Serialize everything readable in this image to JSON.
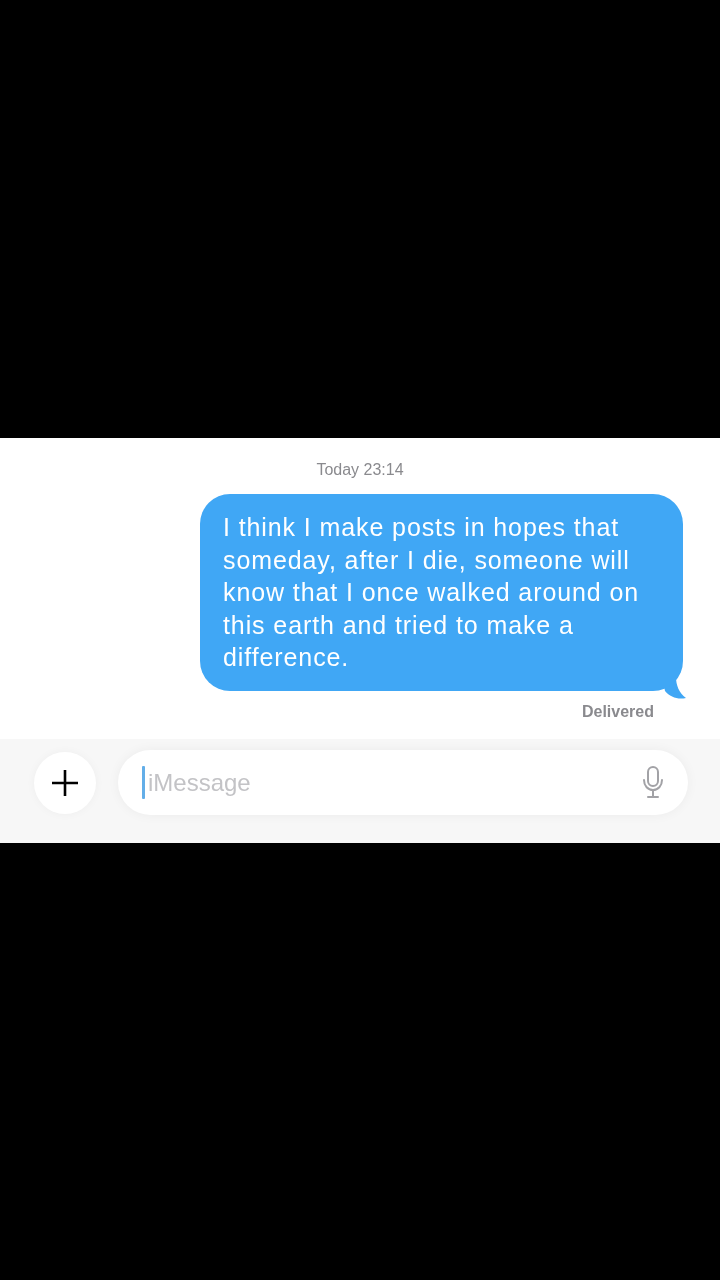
{
  "timestamp": "Today 23:14",
  "messages": [
    {
      "kind": "sent",
      "text": "I think I make posts in hopes that someday, after I die, someone will know that I once walked around on this earth and tried to make a difference.",
      "status": "Delivered"
    }
  ],
  "composer": {
    "placeholder": "iMessage",
    "focused": true
  }
}
